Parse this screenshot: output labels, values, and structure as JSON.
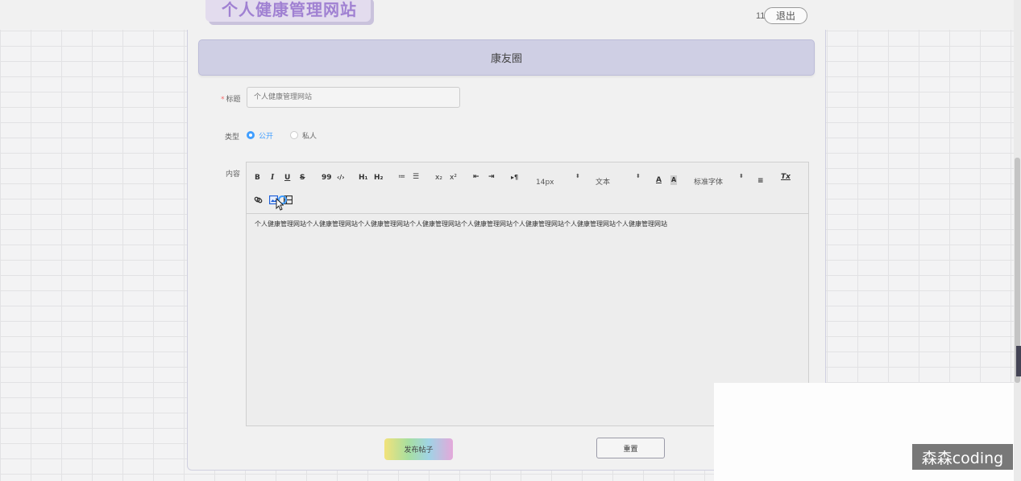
{
  "header": {
    "site_title": "个人健康管理网站",
    "user_count": "11",
    "logout_label": "退出"
  },
  "banner": {
    "title": "康友圈"
  },
  "form": {
    "title_label": "标题",
    "required_mark": "*",
    "title_value": "个人健康管理网站",
    "type_label": "类型",
    "type_options": [
      {
        "label": "公开",
        "selected": true
      },
      {
        "label": "私人",
        "selected": false
      }
    ],
    "content_label": "内容"
  },
  "editor": {
    "toolbar": {
      "bold": "B",
      "italic": "I",
      "underline": "U",
      "strike": "S",
      "blockquote": "99",
      "code": "‹/›",
      "h1": "H₁",
      "h2": "H₂",
      "ordered_list": "≔",
      "bullet_list": "☰",
      "subscript": "x₂",
      "superscript": "x²",
      "outdent": "⇤",
      "indent": "⇥",
      "direction": "▸¶",
      "font_size": "14px",
      "header_select": "文本",
      "font_color": "A",
      "background_color": "A",
      "font_family": "标准字体",
      "align": "≡",
      "clean": "Tx"
    },
    "content": "个人健康管理网站个人健康管理网站个人健康管理网站个人健康管理网站个人健康管理网站个人健康管理网站个人健康管理网站个人健康管理网站"
  },
  "actions": {
    "submit_label": "发布帖子",
    "reset_label": "重置"
  },
  "watermark": "森森coding",
  "colors": {
    "accent": "#409eff",
    "brand": "#a081d2",
    "banner_bg": "#cfcfe4",
    "required": "#f56c6c"
  }
}
